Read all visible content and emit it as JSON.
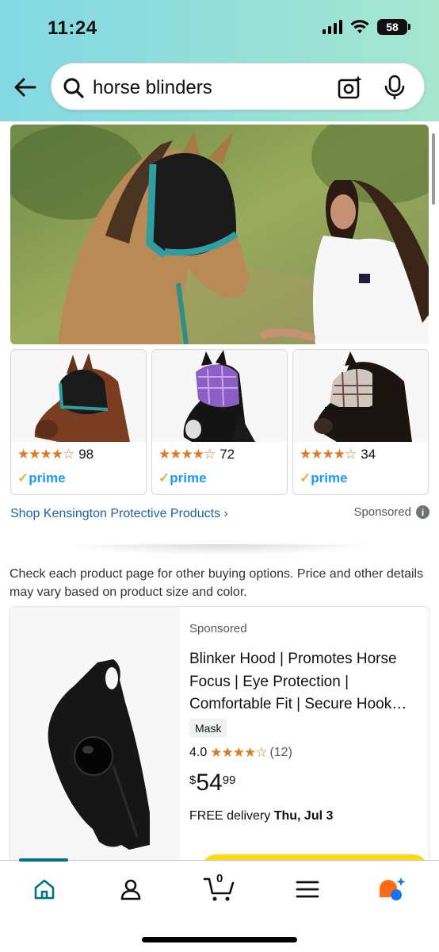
{
  "status_bar": {
    "time": "11:24",
    "battery": "58"
  },
  "search": {
    "query": "horse blinders"
  },
  "brand_ad": {
    "products": [
      {
        "rating_stars": "★★★★☆",
        "rating_count": "98",
        "badge": "prime"
      },
      {
        "rating_stars": "★★★★☆",
        "rating_count": "72",
        "badge": "prime"
      },
      {
        "rating_stars": "★★★★☆",
        "rating_count": "34",
        "badge": "prime"
      }
    ],
    "shop_link": "Shop Kensington Protective Products ›",
    "sponsored_label": "Sponsored",
    "info_glyph": "i"
  },
  "disclaimer": "Check each product page for other buying options. Price and other details may vary based on product size and color.",
  "product": {
    "sponsored_label": "Sponsored",
    "title": "Blinker Hood | Promotes Horse Focus | Eye Protection | Comfortable Fit | Secure Hook…",
    "badge": "Mask",
    "rating": "4.0",
    "rating_stars": "★★★★☆",
    "rating_count": "(12)",
    "price_symbol": "$",
    "price_whole": "54",
    "price_fraction": "99",
    "delivery_prefix": "FREE delivery ",
    "delivery_date": "Thu, Jul 3"
  },
  "bottom_nav": {
    "cart_count": "0"
  },
  "colors": {
    "accent_teal": "#007185",
    "star_orange": "#de7921",
    "link_blue": "#2162a1",
    "prime_blue": "#1a98ff",
    "button_yellow": "#ffd814"
  },
  "icons": [
    "back-arrow-icon",
    "search-icon",
    "camera-icon",
    "microphone-icon",
    "home-icon",
    "account-icon",
    "cart-icon",
    "menu-icon",
    "rufus-icon",
    "info-icon"
  ]
}
